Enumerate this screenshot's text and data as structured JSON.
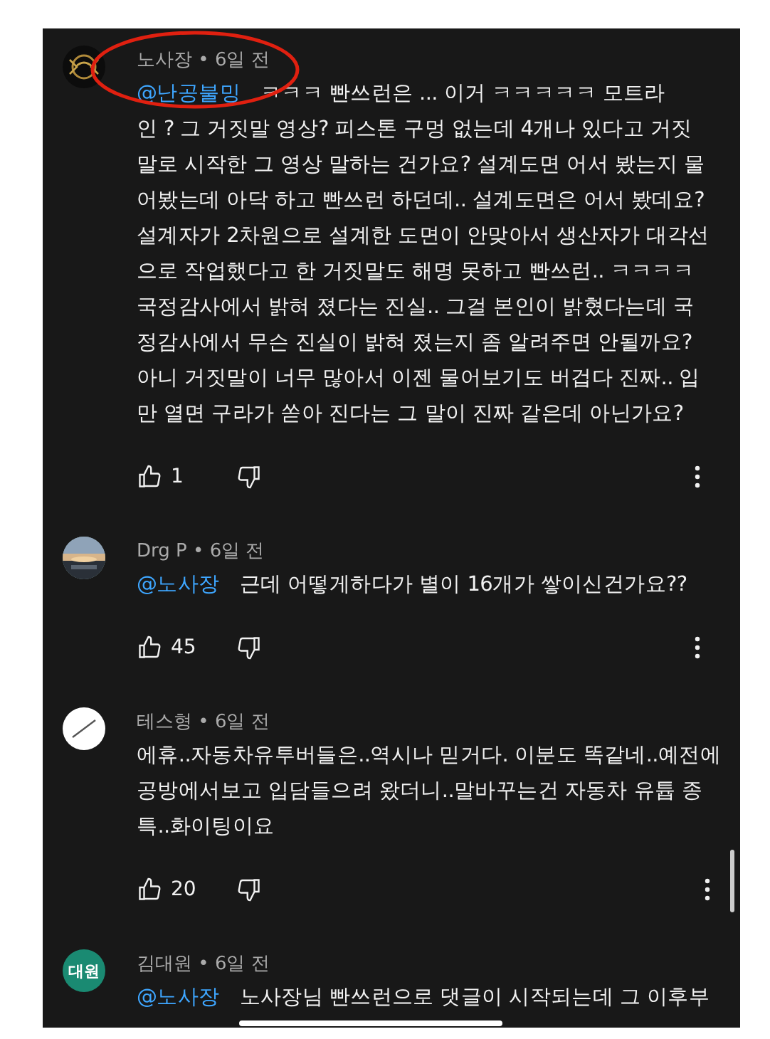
{
  "separator": "•",
  "comments": [
    {
      "author": "노사장",
      "time": "6일 전",
      "avatar": {
        "kind": "logo"
      },
      "highlighted": true,
      "mention": "@난공불밍",
      "lines": [
        "ㅋㅋㅋ  빤쓰런은 ... 이거  ㅋㅋㅋㅋㅋ 모트라",
        "인 ?  그 거짓말 영상?  피스톤 구멍 없는데 4개나 있다고 거짓",
        "말로 시작한 그 영상 말하는 건가요?    설계도면 어서 봤는지 물",
        "어봤는데  아닥 하고 빤쓰런 하던데.. 설계도면은 어서 봤데요?",
        "설계자가 2차원으로 설계한 도면이 안맞아서 생산자가 대각선",
        "으로 작업했다고 한 거짓말도 해명  못하고 빤쓰런.. ㅋㅋㅋㅋ",
        "국정감사에서 밝혀 졌다는 진실.. 그걸  본인이 밝혔다는데  국",
        "정감사에서  무슨 진실이 밝혀 졌는지 좀 알려주면 안될까요?",
        "아니 거짓말이 너무 많아서 이젠 물어보기도 버겁다 진짜..  입",
        "만 열면 구라가 쏟아 진다는 그 말이 진짜 같은데  아닌가요?"
      ],
      "likes": "1"
    },
    {
      "author": "Drg P",
      "time": "6일 전",
      "highlighted": false,
      "mention": "@노사장",
      "lines": [
        "근데 어떻게하다가 별이 16개가 쌓이신건가요??"
      ],
      "likes": "45"
    },
    {
      "author": "테스형",
      "time": "6일 전",
      "avatar": {
        "kind": "slash"
      },
      "highlighted": false,
      "lines": [
        "에휴..자동차유투버들은..역시나 믿거다. 이분도 똑같네..예전에",
        "공방에서보고 입담들으려 왔더니..말바꾸는건 자동차 유튭 종",
        "특..화이팅이요"
      ],
      "likes": "20"
    },
    {
      "author": "김대원",
      "time": "6일 전",
      "avatar": {
        "kind": "initials",
        "text": "대원"
      },
      "highlighted": false,
      "mention": "@노사장",
      "lines": [
        "노사장님 빤쓰런으로 댓글이 시작되는데 그 이후부"
      ]
    }
  ]
}
